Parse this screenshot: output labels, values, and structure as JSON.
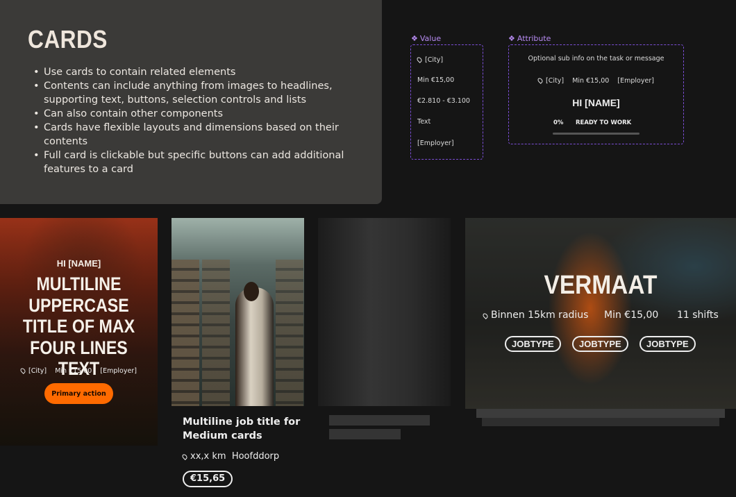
{
  "info": {
    "title": "CARDS",
    "bullets": [
      "Use cards to contain related elements",
      "Contents can include anything from images to headlines, supporting text, buttons, selection controls and lists",
      "Can also contain other components",
      "Cards have flexible layouts and dimensions based on their contents",
      "Full card is clickable but specific buttons can add additional features to a card"
    ]
  },
  "value_panel": {
    "label": "Value",
    "icon": "component-diamond-icon",
    "rows": [
      "[City]",
      "Min €15,00",
      "€2.810 -  €3.100",
      "Text",
      "[Employer]"
    ]
  },
  "attribute_panel": {
    "label": "Attribute",
    "icon": "component-diamond-icon",
    "subinfo": "Optional sub info on the task or message",
    "city": "[City]",
    "min": "Min €15,00",
    "employer": "[Employer]",
    "greeting": "HI [NAME]",
    "progress_label": "0%",
    "progress_value": 0,
    "progress_status": "READY TO WORK"
  },
  "card1": {
    "greeting": "HI [NAME]",
    "title": "MULTILINE UPPERCASE TITLE OF MAX FOUR LINES TEXT",
    "city": "[City]",
    "min": "Min €15,00",
    "employer": "[Employer]",
    "button": "Primary action"
  },
  "card2": {
    "title": "Multiline job title for Medium cards",
    "distance": "xx,x km",
    "location": "Hoofddorp",
    "price": "€15,65"
  },
  "card4": {
    "title": "VERMAAT",
    "radius": "Binnen 15km radius",
    "min": "Min €15,00",
    "shifts": "11 shifts",
    "jobtypes": [
      "JOBTYPE",
      "JOBTYPE",
      "JOBTYPE"
    ]
  },
  "colors": {
    "accent": "#ff6a00",
    "component_purple": "#7b4ed6"
  }
}
